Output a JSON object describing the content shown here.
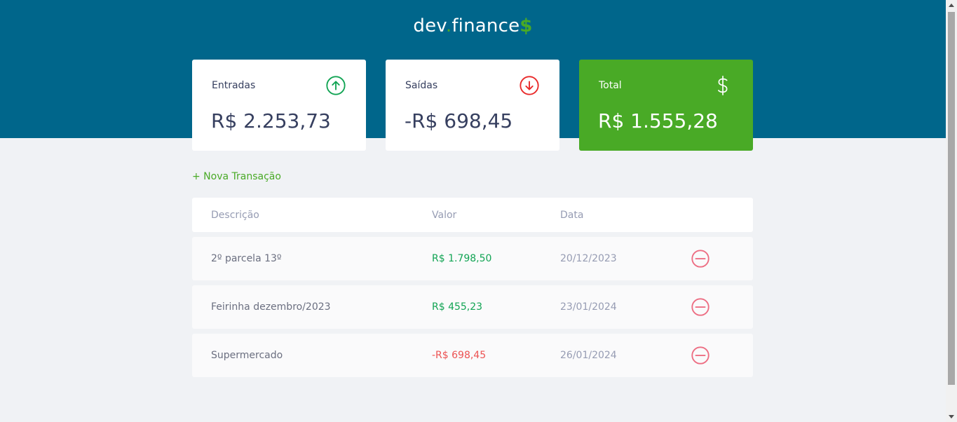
{
  "header": {
    "logo_dev": "dev",
    "logo_dot": ".",
    "logo_finance": "finance",
    "logo_dollar": "$"
  },
  "cards": [
    {
      "label": "Entradas",
      "value": "R$ 2.253,73",
      "icon": "arrow-up-circle-icon",
      "color": "#12a454"
    },
    {
      "label": "Saídas",
      "value": "-R$ 698,45",
      "icon": "arrow-down-circle-icon",
      "color": "#e92929"
    },
    {
      "label": "Total",
      "value": "R$ 1.555,28",
      "icon": "dollar-icon",
      "color": "#ffffff"
    }
  ],
  "new_transaction_label": "+ Nova Transação",
  "table": {
    "headers": [
      "Descrição",
      "Valor",
      "Data"
    ],
    "rows": [
      {
        "description": "2º parcela 13º",
        "amount": "R$ 1.798,50",
        "date": "20/12/2023",
        "type": "income"
      },
      {
        "description": "Feirinha dezembro/2023",
        "amount": "R$ 455,23",
        "date": "23/01/2024",
        "type": "income"
      },
      {
        "description": "Supermercado",
        "amount": "-R$ 698,45",
        "date": "26/01/2024",
        "type": "expense"
      }
    ]
  },
  "colors": {
    "header_bg": "#00668b",
    "brand_green": "#49aa26",
    "income": "#12a454",
    "expense": "#e92929",
    "page_bg": "#f0f2f5"
  }
}
